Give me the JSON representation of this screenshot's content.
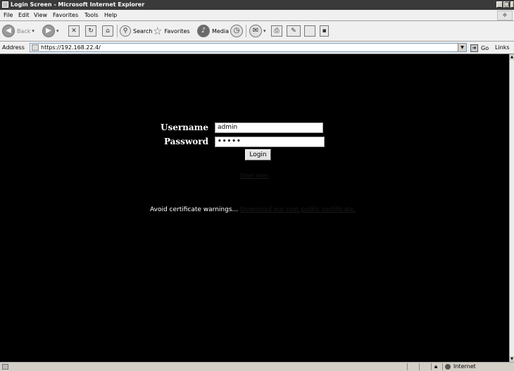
{
  "window": {
    "title": "Login Screen - Microsoft Internet Explorer",
    "controls": [
      "_",
      "❐",
      "×"
    ]
  },
  "menu": [
    "File",
    "Edit",
    "View",
    "Favorites",
    "Tools",
    "Help"
  ],
  "toolbar": {
    "back_label": "Back",
    "search_label": "Search",
    "favorites_label": "Favorites",
    "media_label": "Media"
  },
  "address": {
    "label": "Address",
    "url": "https://192.168.22.4/",
    "go_label": "Go",
    "links_label": "Links"
  },
  "login": {
    "username_label": "Username",
    "username_value": "admin",
    "password_label": "Password",
    "password_value": "•••••",
    "login_button": "Login",
    "start_over": "Start over."
  },
  "certificate": {
    "prefix": "Avoid certificate warnings...",
    "link": "Download our root public certificate."
  },
  "status": {
    "zone": "Internet"
  }
}
